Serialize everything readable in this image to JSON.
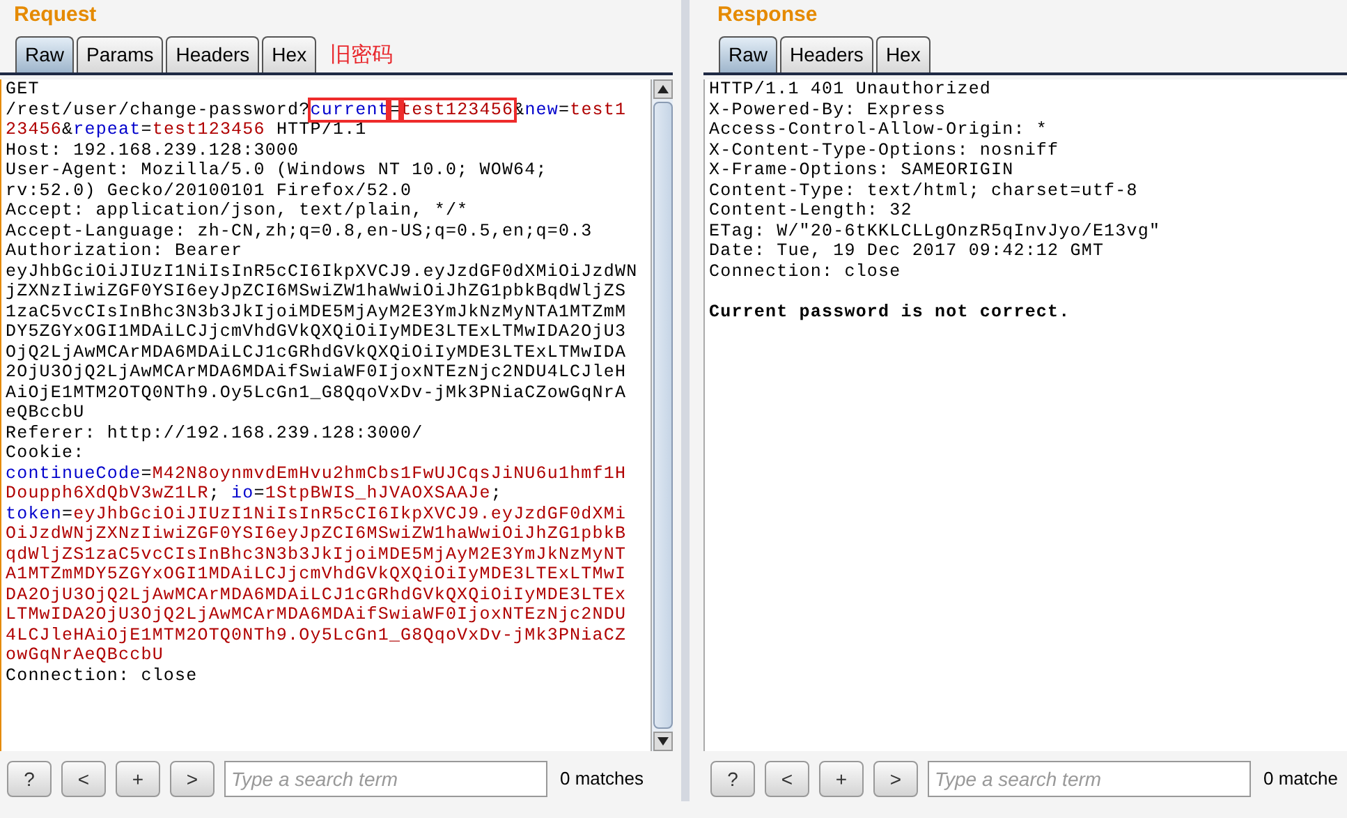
{
  "request": {
    "title": "Request",
    "tabs": [
      {
        "label": "Raw",
        "selected": true
      },
      {
        "label": "Params",
        "selected": false
      },
      {
        "label": "Headers",
        "selected": false
      },
      {
        "label": "Hex",
        "selected": false
      }
    ],
    "annotation": "旧密码",
    "lines": [
      [
        {
          "kind": "plain",
          "text": "GET"
        }
      ],
      [
        {
          "kind": "plain",
          "text": "/rest/user/change-password?"
        },
        {
          "kind": "name",
          "text": "current",
          "highlighted": true
        },
        {
          "kind": "plain",
          "text": "=",
          "highlighted": true
        },
        {
          "kind": "value",
          "text": "test123456",
          "highlighted": true
        },
        {
          "kind": "plain",
          "text": "&"
        },
        {
          "kind": "name",
          "text": "new"
        },
        {
          "kind": "plain",
          "text": "="
        },
        {
          "kind": "value",
          "text": "test1"
        }
      ],
      [
        {
          "kind": "value",
          "text": "23456"
        },
        {
          "kind": "plain",
          "text": "&"
        },
        {
          "kind": "name",
          "text": "repeat"
        },
        {
          "kind": "plain",
          "text": "="
        },
        {
          "kind": "value",
          "text": "test123456"
        },
        {
          "kind": "plain",
          "text": " HTTP/1.1"
        }
      ],
      [
        {
          "kind": "plain",
          "text": "Host: 192.168.239.128:3000"
        }
      ],
      [
        {
          "kind": "plain",
          "text": "User-Agent: Mozilla/5.0 (Windows NT 10.0; WOW64;"
        }
      ],
      [
        {
          "kind": "plain",
          "text": "rv:52.0) Gecko/20100101 Firefox/52.0"
        }
      ],
      [
        {
          "kind": "plain",
          "text": "Accept: application/json, text/plain, */*"
        }
      ],
      [
        {
          "kind": "plain",
          "text": "Accept-Language: zh-CN,zh;q=0.8,en-US;q=0.5,en;q=0.3"
        }
      ],
      [
        {
          "kind": "plain",
          "text": "Authorization: Bearer"
        }
      ],
      [
        {
          "kind": "plain",
          "text": "eyJhbGciOiJIUzI1NiIsInR5cCI6IkpXVCJ9.eyJzdGF0dXMiOiJzdWN"
        }
      ],
      [
        {
          "kind": "plain",
          "text": "jZXNzIiwiZGF0YSI6eyJpZCI6MSwiZW1haWwiOiJhZG1pbkBqdWljZS"
        }
      ],
      [
        {
          "kind": "plain",
          "text": "1zaC5vcCIsInBhc3N3b3JkIjoiMDE5MjAyM2E3YmJkNzMyNTA1MTZmM"
        }
      ],
      [
        {
          "kind": "plain",
          "text": "DY5ZGYxOGI1MDAiLCJjcmVhdGVkQXQiOiIyMDE3LTExLTMwIDA2OjU3"
        }
      ],
      [
        {
          "kind": "plain",
          "text": "OjQ2LjAwMCArMDA6MDAiLCJ1cGRhdGVkQXQiOiIyMDE3LTExLTMwIDA"
        }
      ],
      [
        {
          "kind": "plain",
          "text": "2OjU3OjQ2LjAwMCArMDA6MDAifSwiaWF0IjoxNTEzNjc2NDU4LCJleH"
        }
      ],
      [
        {
          "kind": "plain",
          "text": "AiOjE1MTM2OTQ0NTh9.Oy5LcGn1_G8QqoVxDv-jMk3PNiaCZowGqNrA"
        }
      ],
      [
        {
          "kind": "plain",
          "text": "eQBccbU"
        }
      ],
      [
        {
          "kind": "plain",
          "text": "Referer: http://192.168.239.128:3000/"
        }
      ],
      [
        {
          "kind": "plain",
          "text": "Cookie:"
        }
      ],
      [
        {
          "kind": "name",
          "text": "continueCode"
        },
        {
          "kind": "plain",
          "text": "="
        },
        {
          "kind": "value",
          "text": "M42N8oynmvdEmHvu2hmCbs1FwUJCqsJiNU6u1hmf1H"
        }
      ],
      [
        {
          "kind": "value",
          "text": "Doupph6XdQbV3wZ1LR"
        },
        {
          "kind": "plain",
          "text": "; "
        },
        {
          "kind": "name",
          "text": "io"
        },
        {
          "kind": "plain",
          "text": "="
        },
        {
          "kind": "value",
          "text": "1StpBWIS_hJVAOXSAAJe"
        },
        {
          "kind": "plain",
          "text": ";"
        }
      ],
      [
        {
          "kind": "name",
          "text": "token"
        },
        {
          "kind": "plain",
          "text": "="
        },
        {
          "kind": "value",
          "text": "eyJhbGciOiJIUzI1NiIsInR5cCI6IkpXVCJ9.eyJzdGF0dXMi"
        }
      ],
      [
        {
          "kind": "value",
          "text": "OiJzdWNjZXNzIiwiZGF0YSI6eyJpZCI6MSwiZW1haWwiOiJhZG1pbkB"
        }
      ],
      [
        {
          "kind": "value",
          "text": "qdWljZS1zaC5vcCIsInBhc3N3b3JkIjoiMDE5MjAyM2E3YmJkNzMyNT"
        }
      ],
      [
        {
          "kind": "value",
          "text": "A1MTZmMDY5ZGYxOGI1MDAiLCJjcmVhdGVkQXQiOiIyMDE3LTExLTMwI"
        }
      ],
      [
        {
          "kind": "value",
          "text": "DA2OjU3OjQ2LjAwMCArMDA6MDAiLCJ1cGRhdGVkQXQiOiIyMDE3LTEx"
        }
      ],
      [
        {
          "kind": "value",
          "text": "LTMwIDA2OjU3OjQ2LjAwMCArMDA6MDAifSwiaWF0IjoxNTEzNjc2NDU"
        }
      ],
      [
        {
          "kind": "value",
          "text": "4LCJleHAiOjE1MTM2OTQ0NTh9.Oy5LcGn1_G8QqoVxDv-jMk3PNiaCZ"
        }
      ],
      [
        {
          "kind": "value",
          "text": "owGqNrAeQBccbU"
        }
      ],
      [
        {
          "kind": "plain",
          "text": "Connection: close"
        }
      ]
    ],
    "search": {
      "buttons": [
        "?",
        "<",
        "+",
        ">"
      ],
      "placeholder": "Type a search term",
      "matches": "0 matches"
    }
  },
  "response": {
    "title": "Response",
    "tabs": [
      {
        "label": "Raw",
        "selected": true
      },
      {
        "label": "Headers",
        "selected": false
      },
      {
        "label": "Hex",
        "selected": false
      }
    ],
    "lines": [
      [
        {
          "kind": "plain",
          "text": "HTTP/1.1 401 Unauthorized"
        }
      ],
      [
        {
          "kind": "plain",
          "text": "X-Powered-By: Express"
        }
      ],
      [
        {
          "kind": "plain",
          "text": "Access-Control-Allow-Origin: *"
        }
      ],
      [
        {
          "kind": "plain",
          "text": "X-Content-Type-Options: nosniff"
        }
      ],
      [
        {
          "kind": "plain",
          "text": "X-Frame-Options: SAMEORIGIN"
        }
      ],
      [
        {
          "kind": "plain",
          "text": "Content-Type: text/html; charset=utf-8"
        }
      ],
      [
        {
          "kind": "plain",
          "text": "Content-Length: 32"
        }
      ],
      [
        {
          "kind": "plain",
          "text": "ETag: W/\"20-6tKKLCLLgOnzR5qInvJyo/E13vg\""
        }
      ],
      [
        {
          "kind": "plain",
          "text": "Date: Tue, 19 Dec 2017 09:42:12 GMT"
        }
      ],
      [
        {
          "kind": "plain",
          "text": "Connection: close"
        }
      ],
      [
        {
          "kind": "bold",
          "text": "Current password is not correct.",
          "gap_before": true
        }
      ]
    ],
    "search": {
      "buttons": [
        "?",
        "<",
        "+",
        ">"
      ],
      "placeholder": "Type a search term",
      "matches": "0 matche"
    }
  }
}
